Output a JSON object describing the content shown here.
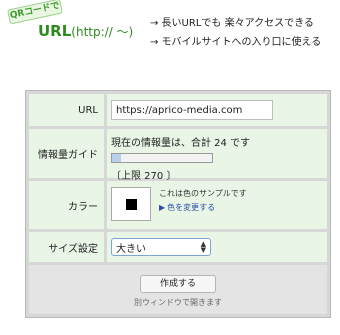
{
  "header": {
    "badge": "QRコードで",
    "logo_main": "URL",
    "logo_sub": "(http:// ～)",
    "features": [
      "→ 長いURLでも 楽々アクセスできる",
      "→ モバイルサイトへの入り口に使える"
    ]
  },
  "form": {
    "url_label": "URL",
    "url_value": "https://aprico-media.com",
    "info_label": "情報量ガイド",
    "info_text": "現在の情報量は、合計 24 です",
    "info_progress": 0.089,
    "limit_text": "〔上限 270 〕",
    "color_label": "カラー",
    "color_sample_text": "これは色のサンプルです",
    "color_change_text": "色を変更する",
    "color_value": "#000000",
    "size_label": "サイズ設定",
    "size_selected": "大きい",
    "submit_label": "作成する",
    "submit_note": "別ウィンドウで開きます"
  },
  "colors": {
    "cell_bg": "#e9f6e6",
    "frame": "#d7d7d7",
    "logo_green": "#2e8a1e",
    "link_blue": "#2a4ea8"
  }
}
